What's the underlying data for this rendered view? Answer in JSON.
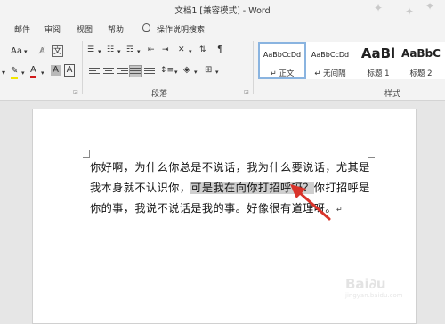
{
  "window": {
    "title": "文档1 [兼容模式] - Word"
  },
  "menu": {
    "items": [
      "邮件",
      "审阅",
      "视图",
      "帮助"
    ],
    "search": "操作说明搜索"
  },
  "ribbon": {
    "font_size_btn": "Aa",
    "font_color_letter": "A",
    "char_shading_letter": "A",
    "char_border_letter": "A",
    "phonetic_letter": "文",
    "paragraph_label": "段落",
    "styles_label": "样式",
    "styles": [
      {
        "sample": "AaBbCcDd",
        "name": "↵ 正文"
      },
      {
        "sample": "AaBbCcDd",
        "name": "↵ 无间隔"
      },
      {
        "sample": "AaBl",
        "name": "标题 1"
      },
      {
        "sample": "AaBbC",
        "name": "标题 2"
      }
    ]
  },
  "document": {
    "before": "你好啊，为什么你总是不说话，我为什么要说话，尤其是我本身就不认识你，",
    "selected": "可是我在向你打招呼呀？",
    "after": "你打招呼是你的事，我说不说话是我的事。好像很有道理呀。"
  },
  "colors": {
    "accent_arrow": "#d9342b",
    "selection": "#cfcfcf",
    "style_selected": "#8ab4e0"
  },
  "watermark": {
    "text": "Bai∂u",
    "sub": "jingyan.baidu.com"
  }
}
